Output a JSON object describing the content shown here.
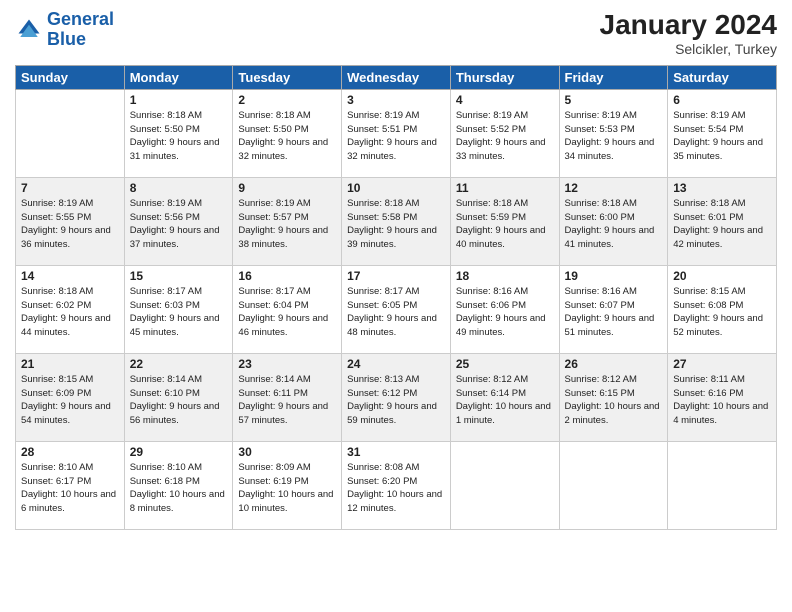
{
  "header": {
    "logo_line1": "General",
    "logo_line2": "Blue",
    "month": "January 2024",
    "location": "Selcikler, Turkey"
  },
  "weekdays": [
    "Sunday",
    "Monday",
    "Tuesday",
    "Wednesday",
    "Thursday",
    "Friday",
    "Saturday"
  ],
  "weeks": [
    {
      "shaded": false,
      "days": [
        {
          "num": "",
          "sunrise": "",
          "sunset": "",
          "daylight": ""
        },
        {
          "num": "1",
          "sunrise": "Sunrise: 8:18 AM",
          "sunset": "Sunset: 5:50 PM",
          "daylight": "Daylight: 9 hours and 31 minutes."
        },
        {
          "num": "2",
          "sunrise": "Sunrise: 8:18 AM",
          "sunset": "Sunset: 5:50 PM",
          "daylight": "Daylight: 9 hours and 32 minutes."
        },
        {
          "num": "3",
          "sunrise": "Sunrise: 8:19 AM",
          "sunset": "Sunset: 5:51 PM",
          "daylight": "Daylight: 9 hours and 32 minutes."
        },
        {
          "num": "4",
          "sunrise": "Sunrise: 8:19 AM",
          "sunset": "Sunset: 5:52 PM",
          "daylight": "Daylight: 9 hours and 33 minutes."
        },
        {
          "num": "5",
          "sunrise": "Sunrise: 8:19 AM",
          "sunset": "Sunset: 5:53 PM",
          "daylight": "Daylight: 9 hours and 34 minutes."
        },
        {
          "num": "6",
          "sunrise": "Sunrise: 8:19 AM",
          "sunset": "Sunset: 5:54 PM",
          "daylight": "Daylight: 9 hours and 35 minutes."
        }
      ]
    },
    {
      "shaded": true,
      "days": [
        {
          "num": "7",
          "sunrise": "Sunrise: 8:19 AM",
          "sunset": "Sunset: 5:55 PM",
          "daylight": "Daylight: 9 hours and 36 minutes."
        },
        {
          "num": "8",
          "sunrise": "Sunrise: 8:19 AM",
          "sunset": "Sunset: 5:56 PM",
          "daylight": "Daylight: 9 hours and 37 minutes."
        },
        {
          "num": "9",
          "sunrise": "Sunrise: 8:19 AM",
          "sunset": "Sunset: 5:57 PM",
          "daylight": "Daylight: 9 hours and 38 minutes."
        },
        {
          "num": "10",
          "sunrise": "Sunrise: 8:18 AM",
          "sunset": "Sunset: 5:58 PM",
          "daylight": "Daylight: 9 hours and 39 minutes."
        },
        {
          "num": "11",
          "sunrise": "Sunrise: 8:18 AM",
          "sunset": "Sunset: 5:59 PM",
          "daylight": "Daylight: 9 hours and 40 minutes."
        },
        {
          "num": "12",
          "sunrise": "Sunrise: 8:18 AM",
          "sunset": "Sunset: 6:00 PM",
          "daylight": "Daylight: 9 hours and 41 minutes."
        },
        {
          "num": "13",
          "sunrise": "Sunrise: 8:18 AM",
          "sunset": "Sunset: 6:01 PM",
          "daylight": "Daylight: 9 hours and 42 minutes."
        }
      ]
    },
    {
      "shaded": false,
      "days": [
        {
          "num": "14",
          "sunrise": "Sunrise: 8:18 AM",
          "sunset": "Sunset: 6:02 PM",
          "daylight": "Daylight: 9 hours and 44 minutes."
        },
        {
          "num": "15",
          "sunrise": "Sunrise: 8:17 AM",
          "sunset": "Sunset: 6:03 PM",
          "daylight": "Daylight: 9 hours and 45 minutes."
        },
        {
          "num": "16",
          "sunrise": "Sunrise: 8:17 AM",
          "sunset": "Sunset: 6:04 PM",
          "daylight": "Daylight: 9 hours and 46 minutes."
        },
        {
          "num": "17",
          "sunrise": "Sunrise: 8:17 AM",
          "sunset": "Sunset: 6:05 PM",
          "daylight": "Daylight: 9 hours and 48 minutes."
        },
        {
          "num": "18",
          "sunrise": "Sunrise: 8:16 AM",
          "sunset": "Sunset: 6:06 PM",
          "daylight": "Daylight: 9 hours and 49 minutes."
        },
        {
          "num": "19",
          "sunrise": "Sunrise: 8:16 AM",
          "sunset": "Sunset: 6:07 PM",
          "daylight": "Daylight: 9 hours and 51 minutes."
        },
        {
          "num": "20",
          "sunrise": "Sunrise: 8:15 AM",
          "sunset": "Sunset: 6:08 PM",
          "daylight": "Daylight: 9 hours and 52 minutes."
        }
      ]
    },
    {
      "shaded": true,
      "days": [
        {
          "num": "21",
          "sunrise": "Sunrise: 8:15 AM",
          "sunset": "Sunset: 6:09 PM",
          "daylight": "Daylight: 9 hours and 54 minutes."
        },
        {
          "num": "22",
          "sunrise": "Sunrise: 8:14 AM",
          "sunset": "Sunset: 6:10 PM",
          "daylight": "Daylight: 9 hours and 56 minutes."
        },
        {
          "num": "23",
          "sunrise": "Sunrise: 8:14 AM",
          "sunset": "Sunset: 6:11 PM",
          "daylight": "Daylight: 9 hours and 57 minutes."
        },
        {
          "num": "24",
          "sunrise": "Sunrise: 8:13 AM",
          "sunset": "Sunset: 6:12 PM",
          "daylight": "Daylight: 9 hours and 59 minutes."
        },
        {
          "num": "25",
          "sunrise": "Sunrise: 8:12 AM",
          "sunset": "Sunset: 6:14 PM",
          "daylight": "Daylight: 10 hours and 1 minute."
        },
        {
          "num": "26",
          "sunrise": "Sunrise: 8:12 AM",
          "sunset": "Sunset: 6:15 PM",
          "daylight": "Daylight: 10 hours and 2 minutes."
        },
        {
          "num": "27",
          "sunrise": "Sunrise: 8:11 AM",
          "sunset": "Sunset: 6:16 PM",
          "daylight": "Daylight: 10 hours and 4 minutes."
        }
      ]
    },
    {
      "shaded": false,
      "days": [
        {
          "num": "28",
          "sunrise": "Sunrise: 8:10 AM",
          "sunset": "Sunset: 6:17 PM",
          "daylight": "Daylight: 10 hours and 6 minutes."
        },
        {
          "num": "29",
          "sunrise": "Sunrise: 8:10 AM",
          "sunset": "Sunset: 6:18 PM",
          "daylight": "Daylight: 10 hours and 8 minutes."
        },
        {
          "num": "30",
          "sunrise": "Sunrise: 8:09 AM",
          "sunset": "Sunset: 6:19 PM",
          "daylight": "Daylight: 10 hours and 10 minutes."
        },
        {
          "num": "31",
          "sunrise": "Sunrise: 8:08 AM",
          "sunset": "Sunset: 6:20 PM",
          "daylight": "Daylight: 10 hours and 12 minutes."
        },
        {
          "num": "",
          "sunrise": "",
          "sunset": "",
          "daylight": ""
        },
        {
          "num": "",
          "sunrise": "",
          "sunset": "",
          "daylight": ""
        },
        {
          "num": "",
          "sunrise": "",
          "sunset": "",
          "daylight": ""
        }
      ]
    }
  ]
}
